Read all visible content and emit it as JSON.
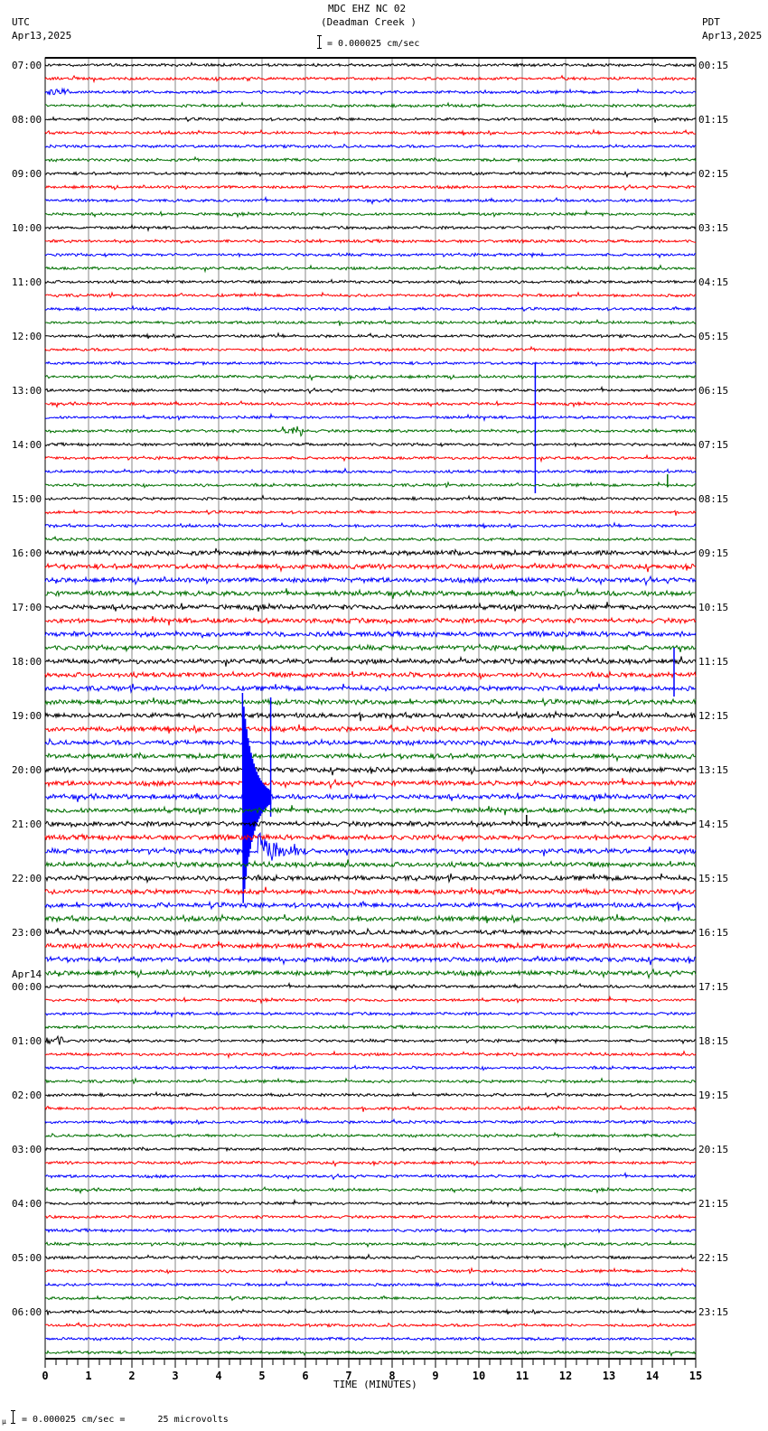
{
  "header": {
    "title": "MDC EHZ NC 02",
    "subtitle": "(Deadman Creek )",
    "left_tz": "UTC",
    "left_date": "Apr13,2025",
    "right_tz": "PDT",
    "right_date": "Apr13,2025",
    "scale": "= 0.000025 cm/sec"
  },
  "footer": {
    "scale": "= 0.000025 cm/sec =      25 microvolts"
  },
  "chart_data": {
    "type": "line",
    "title": "MDC EHZ NC 02 (Deadman Creek )",
    "xlabel": "TIME (MINUTES)",
    "xlim": [
      0,
      15
    ],
    "x_ticks": [
      "0",
      "1",
      "2",
      "3",
      "4",
      "5",
      "6",
      "7",
      "8",
      "9",
      "10",
      "11",
      "12",
      "13",
      "14",
      "15"
    ],
    "minutes_per_trace": 15,
    "trace_count": 96,
    "trace_colors": [
      "#000000",
      "#ff0000",
      "#0000ff",
      "#007000"
    ],
    "grid": true,
    "left_labels": [
      "07:00",
      "08:00",
      "09:00",
      "10:00",
      "11:00",
      "12:00",
      "13:00",
      "14:00",
      "15:00",
      "16:00",
      "17:00",
      "18:00",
      "19:00",
      "20:00",
      "21:00",
      "22:00",
      "23:00",
      "00:00",
      "01:00",
      "02:00",
      "03:00",
      "04:00",
      "05:00",
      "06:00"
    ],
    "date_change_label": "Apr14",
    "right_labels": [
      "00:15",
      "01:15",
      "02:15",
      "03:15",
      "04:15",
      "05:15",
      "06:15",
      "07:15",
      "08:15",
      "09:15",
      "10:15",
      "11:15",
      "12:15",
      "13:15",
      "14:15",
      "15:15",
      "16:15",
      "17:15",
      "18:15",
      "19:15",
      "20:15",
      "21:15",
      "22:15",
      "23:15"
    ],
    "events": [
      {
        "trace": 30,
        "minute": 11.3,
        "amplitude": 120,
        "kind": "spike"
      },
      {
        "trace": 54,
        "minute": 4.55,
        "amplitude": 115,
        "kind": "quake"
      },
      {
        "trace": 54,
        "minute": 5.2,
        "amplitude": 110,
        "kind": "spike"
      },
      {
        "trace": 58,
        "minute": 4.9,
        "amplitude": 25,
        "kind": "coda"
      },
      {
        "trace": 46,
        "minute": 14.5,
        "amplitude": 45,
        "kind": "spike"
      },
      {
        "trace": 31,
        "minute": 14.35,
        "amplitude": 12,
        "kind": "spike"
      },
      {
        "trace": 27,
        "minute": 5.7,
        "amplitude": 8,
        "kind": "burst"
      },
      {
        "trace": 2,
        "minute": 0.3,
        "amplitude": 6,
        "kind": "burst"
      },
      {
        "trace": 72,
        "minute": 0.2,
        "amplitude": 8,
        "kind": "burst"
      },
      {
        "trace": 56,
        "minute": 11.1,
        "amplitude": 10,
        "kind": "spike"
      }
    ]
  }
}
